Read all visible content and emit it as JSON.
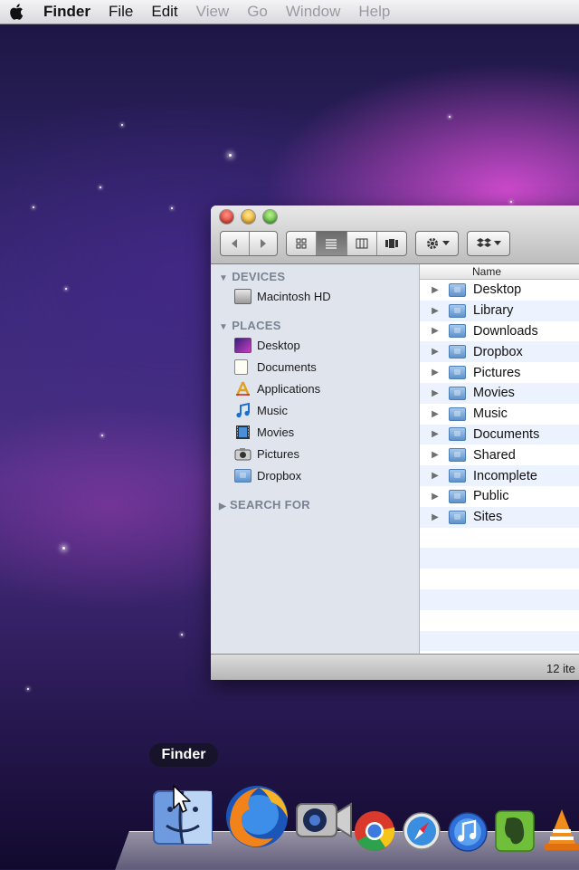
{
  "menubar": {
    "app_name": "Finder",
    "items": [
      "File",
      "Edit",
      "View",
      "Go",
      "Window",
      "Help"
    ]
  },
  "finder": {
    "column_header": "Name",
    "sidebar": {
      "devices_label": "DEVICES",
      "devices": [
        "Macintosh HD"
      ],
      "places_label": "PLACES",
      "places": [
        "Desktop",
        "Documents",
        "Applications",
        "Music",
        "Movies",
        "Pictures",
        "Dropbox"
      ],
      "search_label": "SEARCH FOR"
    },
    "items": [
      "Desktop",
      "Library",
      "Downloads",
      "Dropbox",
      "Pictures",
      "Movies",
      "Music",
      "Documents",
      "Shared",
      "Incomplete",
      "Public",
      "Sites"
    ],
    "status": "12 ite"
  },
  "dock": {
    "tooltip": "Finder",
    "apps": [
      "finder",
      "firefox",
      "facetime-camera",
      "chrome",
      "safari",
      "itunes",
      "evernote",
      "vlc"
    ]
  },
  "colors": {
    "sidebar_bg": "#dfe4ed",
    "row_stripe": "#edf3fe",
    "menubar_bg": "#e8e8ec"
  }
}
